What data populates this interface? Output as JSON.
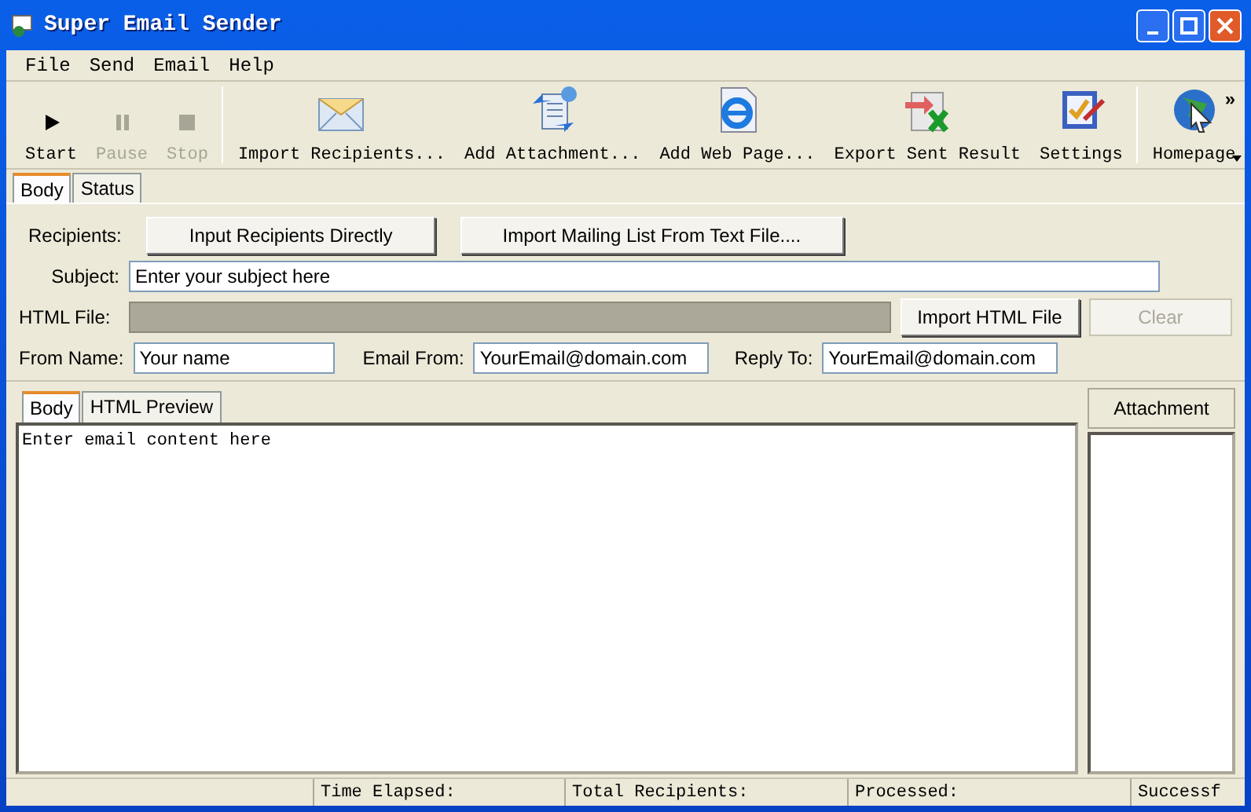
{
  "window": {
    "title": "Super Email Sender"
  },
  "menu": [
    "File",
    "Send",
    "Email",
    "Help"
  ],
  "toolbar": [
    {
      "label": "Start",
      "kind": "play",
      "disabled": false
    },
    {
      "label": "Pause",
      "kind": "pause",
      "disabled": true
    },
    {
      "label": "Stop",
      "kind": "stop",
      "disabled": true
    },
    {
      "label": "Import Recipients...",
      "kind": "envelope",
      "disabled": false
    },
    {
      "label": "Add Attachment...",
      "kind": "attach",
      "disabled": false
    },
    {
      "label": "Add Web Page...",
      "kind": "web",
      "disabled": false
    },
    {
      "label": "Export Sent Result",
      "kind": "export",
      "disabled": false
    },
    {
      "label": "Settings",
      "kind": "settings",
      "disabled": false
    },
    {
      "label": "Homepage",
      "kind": "globe",
      "disabled": false
    }
  ],
  "toolbar_overflow": "»",
  "outer_tabs": [
    {
      "label": "Body",
      "selected": true
    },
    {
      "label": "Status",
      "selected": false
    }
  ],
  "form": {
    "recipients_label": "Recipients:",
    "recipient_buttons": [
      "Input Recipients Directly",
      "Import Mailing List From Text File...."
    ],
    "subject_label": "Subject:",
    "subject_value": "Enter your subject here",
    "html_file_label": "HTML File:",
    "html_file_disabled": true,
    "html_buttons": [
      {
        "label": "Import HTML File",
        "disabled": false
      },
      {
        "label": "Clear",
        "disabled": true
      }
    ],
    "from_name_label": "From Name:",
    "from_name_value": "Your name",
    "email_from_label": "Email From:",
    "email_from_value": "YourEmail@domain.com",
    "reply_to_label": "Reply To:",
    "reply_to_value": "YourEmail@domain.com"
  },
  "inner_tabs": [
    {
      "label": "Body",
      "selected": true
    },
    {
      "label": "HTML Preview",
      "selected": false
    }
  ],
  "editor": {
    "value": "Enter email content here"
  },
  "attachment_button": "Attachment",
  "status_bar": [
    "Time Elapsed:",
    "Total Recipients:",
    "Processed:",
    "Successf"
  ]
}
